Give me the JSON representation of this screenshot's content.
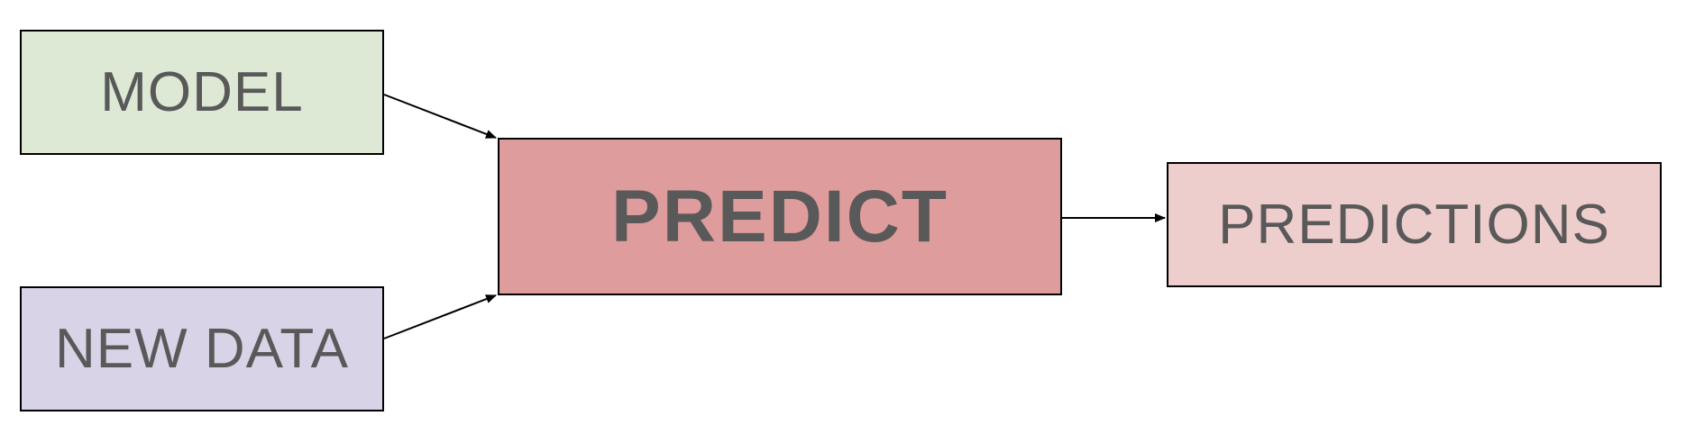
{
  "diagram": {
    "nodes": {
      "model": {
        "label": "MODEL",
        "fill": "#dde9d5"
      },
      "new_data": {
        "label": "NEW DATA",
        "fill": "#d8d3e6"
      },
      "predict": {
        "label": "PREDICT",
        "fill": "#df9c9c"
      },
      "predictions": {
        "label": "PREDICTIONS",
        "fill": "#eececd"
      }
    },
    "edges": [
      {
        "from": "MODEL",
        "to": "PREDICT"
      },
      {
        "from": "NEW DATA",
        "to": "PREDICT"
      },
      {
        "from": "PREDICT",
        "to": "PREDICTIONS"
      }
    ],
    "border_color": "#000000",
    "text_color": "#595959"
  }
}
